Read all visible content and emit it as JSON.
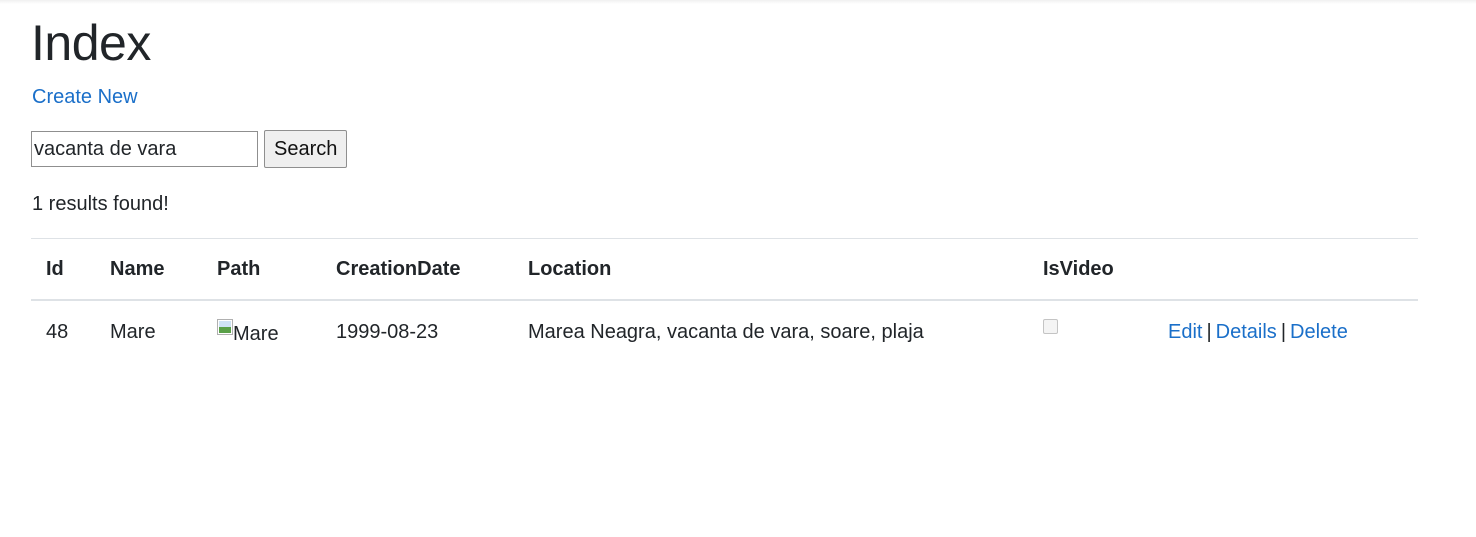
{
  "page": {
    "title": "Index",
    "create_link": "Create New"
  },
  "search": {
    "value": "vacanta de vara",
    "button_label": "Search"
  },
  "results_text": "1 results found!",
  "table": {
    "headers": {
      "id": "Id",
      "name": "Name",
      "path": "Path",
      "creation_date": "CreationDate",
      "location": "Location",
      "is_video": "IsVideo"
    },
    "rows": [
      {
        "id": "48",
        "name": "Mare",
        "path_alt": "Mare",
        "creation_date": "1999-08-23",
        "location": "Marea Neagra, vacanta de vara, soare, plaja",
        "is_video": false,
        "actions": {
          "edit": "Edit",
          "separator": "|",
          "details": "Details",
          "delete": "Delete"
        }
      }
    ]
  },
  "colors": {
    "link": "#1a6fc9",
    "text": "#212529",
    "border": "#dee2e6"
  }
}
